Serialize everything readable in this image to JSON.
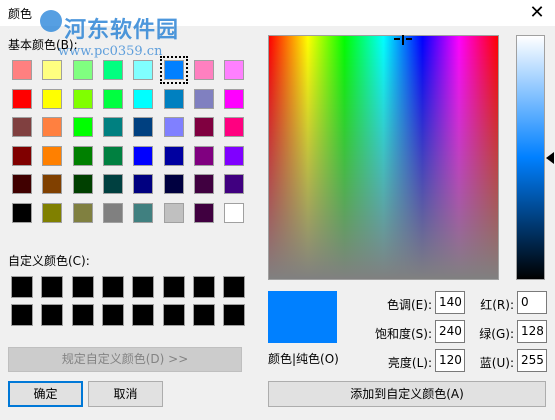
{
  "window": {
    "title": "颜色",
    "close_glyph": "✕"
  },
  "watermark": {
    "title": "河东软件园",
    "url": "www.pc0359.cn"
  },
  "basic_colors": {
    "label": "基本颜色(B):",
    "rows": [
      [
        "#ff8080",
        "#ffff80",
        "#80ff80",
        "#00ff80",
        "#80ffff",
        "#0080ff",
        "#ff80c0",
        "#ff80ff"
      ],
      [
        "#ff0000",
        "#ffff00",
        "#80ff00",
        "#00ff40",
        "#00ffff",
        "#0080c0",
        "#8080c0",
        "#ff00ff"
      ],
      [
        "#804040",
        "#ff8040",
        "#00ff00",
        "#008080",
        "#004080",
        "#8080ff",
        "#800040",
        "#ff0080"
      ],
      [
        "#800000",
        "#ff8000",
        "#008000",
        "#008040",
        "#0000ff",
        "#0000a0",
        "#800080",
        "#8000ff"
      ],
      [
        "#400000",
        "#804000",
        "#004000",
        "#004040",
        "#000080",
        "#000040",
        "#400040",
        "#400080"
      ],
      [
        "#000000",
        "#808000",
        "#808040",
        "#808080",
        "#408080",
        "#c0c0c0",
        "#400040",
        "#ffffff"
      ]
    ],
    "selected_row": 0,
    "selected_col": 5
  },
  "custom_colors": {
    "label": "自定义颜色(C):",
    "rows": [
      [
        "#000000",
        "#000000",
        "#000000",
        "#000000",
        "#000000",
        "#000000",
        "#000000",
        "#000000"
      ],
      [
        "#000000",
        "#000000",
        "#000000",
        "#000000",
        "#000000",
        "#000000",
        "#000000",
        "#000000"
      ]
    ]
  },
  "buttons": {
    "define_custom": "规定自定义颜色(D) >>",
    "ok": "确定",
    "cancel": "取消",
    "add_custom": "添加到自定义颜色(A)"
  },
  "preview": {
    "label": "颜色|纯色(O)",
    "color": "#0080ff"
  },
  "fields": {
    "hue": {
      "label": "色调(E):",
      "value": "140"
    },
    "sat": {
      "label": "饱和度(S):",
      "value": "240"
    },
    "lum": {
      "label": "亮度(L):",
      "value": "120"
    },
    "red": {
      "label": "红(R):",
      "value": "0"
    },
    "green": {
      "label": "绿(G):",
      "value": "128"
    },
    "blue": {
      "label": "蓝(U):",
      "value": "255"
    }
  }
}
